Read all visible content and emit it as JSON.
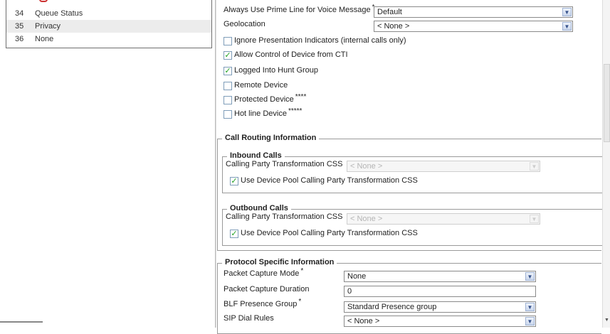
{
  "left_list": [
    {
      "num": "34",
      "label": "Queue Status"
    },
    {
      "num": "35",
      "label": "Privacy"
    },
    {
      "num": "36",
      "label": "None"
    }
  ],
  "device": {
    "prime_line_label": "Always Use Prime Line for Voice Message",
    "prime_line_value": "Default",
    "geolocation_label": "Geolocation",
    "geolocation_value": "< None >",
    "checkboxes": [
      {
        "label": "Ignore Presentation Indicators (internal calls only)",
        "checked": false
      },
      {
        "label": "Allow Control of Device from CTI",
        "checked": true
      },
      {
        "label": "Logged Into Hunt Group",
        "checked": true
      },
      {
        "label": "Remote Device",
        "checked": false
      },
      {
        "label": "Protected Device",
        "suffix": "****",
        "checked": false
      },
      {
        "label": "Hot line Device",
        "suffix": "*****",
        "checked": false
      }
    ]
  },
  "call_routing": {
    "title": "Call Routing Information",
    "inbound": {
      "title": "Inbound Calls",
      "css_label": "Calling Party Transformation CSS",
      "css_value": "< None >",
      "checkbox_label": "Use Device Pool Calling Party Transformation CSS"
    },
    "outbound": {
      "title": "Outbound Calls",
      "css_label": "Calling Party Transformation CSS",
      "css_value": "< None >",
      "checkbox_label": "Use Device Pool Calling Party Transformation CSS"
    }
  },
  "protocol": {
    "title": "Protocol Specific Information",
    "packet_capture_mode_label": "Packet Capture Mode",
    "packet_capture_mode_value": "None",
    "packet_capture_duration_label": "Packet Capture Duration",
    "packet_capture_duration_value": "0",
    "blf_label": "BLF Presence Group",
    "blf_value": "Standard Presence group",
    "sip_dial_label": "SIP Dial Rules",
    "sip_dial_value": "< None >"
  },
  "symbols": {
    "required": "*",
    "check": "✓",
    "dropdown": "▼"
  }
}
